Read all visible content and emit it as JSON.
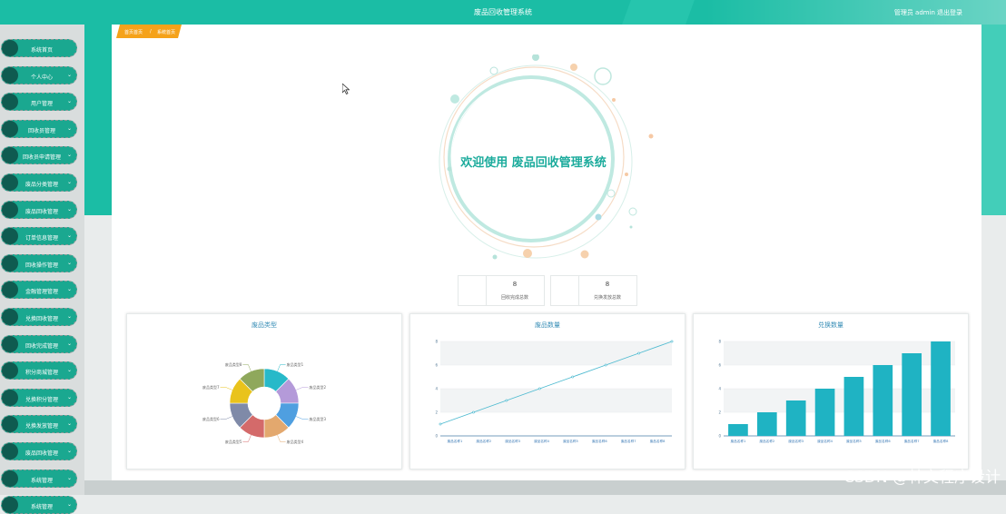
{
  "header": {
    "title": "废品回收管理系统",
    "user_label": "管理员 admin",
    "logout_label": "退出登录"
  },
  "breadcrumb": {
    "home": "首页首页",
    "separator": "/",
    "current": "系统首页"
  },
  "sidebar": {
    "items": [
      {
        "label": "系统首页"
      },
      {
        "label": "个人中心"
      },
      {
        "label": "用户管理"
      },
      {
        "label": "回收员管理"
      },
      {
        "label": "回收员申请管理"
      },
      {
        "label": "废品分类管理"
      },
      {
        "label": "废品回收管理"
      },
      {
        "label": "订单信息管理"
      },
      {
        "label": "回收操作管理"
      },
      {
        "label": "金融管理管理"
      },
      {
        "label": "兑换回收管理"
      },
      {
        "label": "回收完成管理"
      },
      {
        "label": "积分商城管理"
      },
      {
        "label": "兑换积分管理"
      },
      {
        "label": "兑换发放管理"
      },
      {
        "label": "废品回收管理"
      },
      {
        "label": "系统管理"
      },
      {
        "label": "系统管理"
      }
    ]
  },
  "welcome": {
    "text": "欢迎使用 废品回收管理系统"
  },
  "stats": [
    {
      "value": "8",
      "label": "回收完成总数"
    },
    {
      "value": "8",
      "label": "兑换发放总数"
    }
  ],
  "colors": {
    "primary": "#1bbda5",
    "accent": "#f5a21a",
    "bar": "#1fb3c3",
    "line": "#4dbad0"
  },
  "chart_data": [
    {
      "type": "pie",
      "title": "废品类型",
      "categories": [
        "废品类型1",
        "废品类型2",
        "废品类型3",
        "废品类型4",
        "废品类型5",
        "废品类型6",
        "废品类型7",
        "废品类型8"
      ],
      "values": [
        1,
        1,
        1,
        1,
        1,
        1,
        1,
        1
      ],
      "colors": [
        "#27b9c9",
        "#b49ad9",
        "#4f9fe0",
        "#e3a86e",
        "#d46a6a",
        "#7f8aa8",
        "#e9c31c",
        "#8fa85c"
      ],
      "donut": true
    },
    {
      "type": "line",
      "title": "废品数量",
      "categories": [
        "废品名称1",
        "废品名称2",
        "废品名称3",
        "废品名称4",
        "废品名称5",
        "废品名称6",
        "废品名称7",
        "废品名称8"
      ],
      "values": [
        1,
        2,
        3,
        4,
        5,
        6,
        7,
        8
      ],
      "ylim": [
        0,
        8
      ],
      "yticks": [
        "0",
        "2",
        "4",
        "6",
        "8"
      ],
      "grid": true
    },
    {
      "type": "bar",
      "title": "兑换数量",
      "categories": [
        "废品名称1",
        "废品名称2",
        "废品名称3",
        "废品名称4",
        "废品名称5",
        "废品名称6",
        "废品名称7",
        "废品名称8"
      ],
      "values": [
        1,
        2,
        3,
        4,
        5,
        6,
        7,
        8
      ],
      "ylim": [
        0,
        8
      ],
      "yticks": [
        "0",
        "2",
        "4",
        "6",
        "8"
      ],
      "grid": true
    }
  ],
  "watermark": "CSDN @林文程序设计"
}
